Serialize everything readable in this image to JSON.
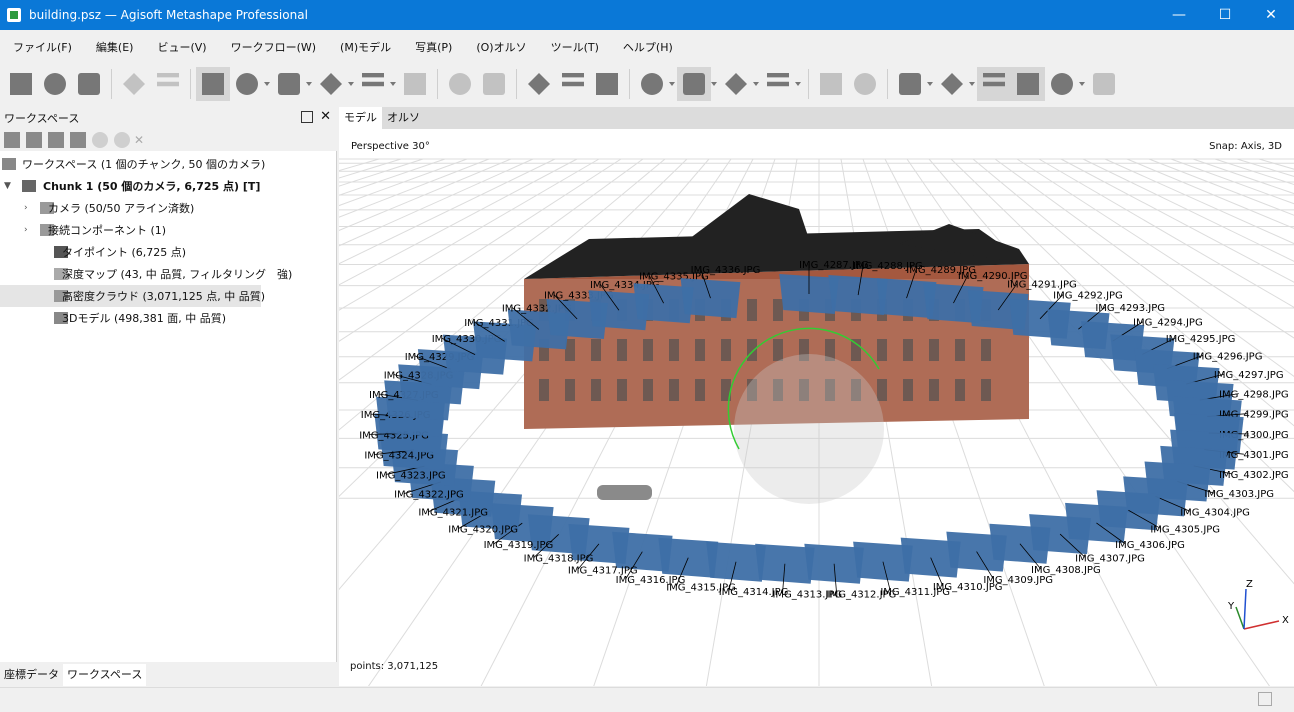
{
  "window": {
    "title": "building.psz — Agisoft Metashape Professional",
    "controls": [
      "—",
      "☐",
      "✕"
    ]
  },
  "menu": [
    "ファイル(F)",
    "編集(E)",
    "ビュー(V)",
    "ワークフロー(W)",
    "(M)モデル",
    "写真(P)",
    "(O)オルソ",
    "ツール(T)",
    "ヘルプ(H)"
  ],
  "toolbar": {
    "buttons": [
      {
        "name": "new-icon",
        "disabled": false
      },
      {
        "name": "open-icon",
        "disabled": false
      },
      {
        "name": "save-icon",
        "disabled": false
      },
      {
        "name": "undo-icon",
        "disabled": true
      },
      {
        "name": "redo-icon",
        "disabled": true
      },
      {
        "name": "navigation-icon",
        "disabled": false,
        "pressed": true
      },
      {
        "name": "rectangle-selection-icon",
        "disabled": false,
        "caret": true
      },
      {
        "name": "move-object-icon",
        "disabled": false,
        "caret": true
      },
      {
        "name": "region-icon",
        "disabled": false,
        "caret": true
      },
      {
        "name": "ruler-icon",
        "disabled": false,
        "caret": true
      },
      {
        "name": "draw-icon",
        "disabled": true
      },
      {
        "name": "delete-selection-icon",
        "disabled": true
      },
      {
        "name": "crop-icon",
        "disabled": true
      },
      {
        "name": "zoom-in-icon",
        "disabled": false
      },
      {
        "name": "zoom-out-icon",
        "disabled": false
      },
      {
        "name": "reset-view-icon",
        "disabled": false
      },
      {
        "name": "points-icon",
        "disabled": false,
        "caret": true
      },
      {
        "name": "dense-cloud-icon",
        "disabled": false,
        "caret": true,
        "pressed": true
      },
      {
        "name": "model-shaded-icon",
        "disabled": false,
        "caret": true
      },
      {
        "name": "tiled-model-icon",
        "disabled": false,
        "caret": true
      },
      {
        "name": "dem-icon",
        "disabled": true
      },
      {
        "name": "ortho-icon",
        "disabled": true
      },
      {
        "name": "globe-icon",
        "disabled": false,
        "caret": true
      },
      {
        "name": "camera-icon",
        "disabled": false,
        "caret": true
      },
      {
        "name": "show-cameras-icon",
        "disabled": false,
        "pressed": true
      },
      {
        "name": "markers-icon",
        "disabled": false,
        "pressed": true
      },
      {
        "name": "images-icon",
        "disabled": false,
        "caret": true
      },
      {
        "name": "layers-icon",
        "disabled": true
      }
    ]
  },
  "workspace": {
    "header": "ワークスペース",
    "tree": [
      {
        "label": "ワークスペース (1 個のチャンク, 50 個のカメラ)",
        "indent": 0,
        "bold": false,
        "icon": "workspace-icon"
      },
      {
        "label": "Chunk 1 (50 個のカメラ, 6,725 点) [T]",
        "indent": 1,
        "bold": true,
        "icon": "chunk-icon",
        "expanded": true
      },
      {
        "label": "カメラ (50/50 アライン済数)",
        "indent": 2,
        "bold": false,
        "icon": "folder-icon",
        "expandable": true
      },
      {
        "label": "接続コンポーネント (1)",
        "indent": 2,
        "bold": false,
        "icon": "folder-icon",
        "expandable": true
      },
      {
        "label": "タイポイント (6,725 点)",
        "indent": 3,
        "bold": false,
        "icon": "tie-points-icon"
      },
      {
        "label": "深度マップ (43, 中 品質, フィルタリング　強)",
        "indent": 3,
        "bold": false,
        "icon": "depth-maps-icon"
      },
      {
        "label": "高密度クラウド (3,071,125 点, 中 品質)",
        "indent": 3,
        "bold": false,
        "icon": "dense-cloud-icon",
        "selected": true
      },
      {
        "label": "3Dモデル (498,381 面, 中 品質)",
        "indent": 3,
        "bold": false,
        "icon": "model-icon"
      }
    ]
  },
  "bottom_tabs": [
    "座標データ",
    "ワークスペース"
  ],
  "view_tabs": [
    "モデル",
    "オルソ"
  ],
  "viewport": {
    "projection": "Perspective 30°",
    "snap": "Snap: Axis, 3D",
    "points": "points: 3,071,125",
    "axes": {
      "x": "X",
      "y": "Y",
      "z": "Z"
    },
    "camera_labels": [
      "IMG_4287.JPG",
      "IMG_4288.JPG",
      "IMG_4289.JPG",
      "IMG_4290.JPG",
      "IMG_4291.JPG",
      "IMG_4292.JPG",
      "IMG_4293.JPG",
      "IMG_4294.JPG",
      "IMG_4295.JPG",
      "IMG_4296.JPG",
      "IMG_4297.JPG",
      "IMG_4298.JPG",
      "IMG_4299.JPG",
      "IMG_4300.JPG",
      "IMG_4301.JPG",
      "IMG_4302.JPG",
      "IMG_4303.JPG",
      "IMG_4304.JPG",
      "IMG_4305.JPG",
      "IMG_4306.JPG",
      "IMG_4307.JPG",
      "IMG_4308.JPG",
      "IMG_4309.JPG",
      "IMG_4310.JPG",
      "IMG_4311.JPG",
      "IMG_4312.JPG",
      "IMG_4313.JPG",
      "IMG_4314.JPG",
      "IMG_4315.JPG",
      "IMG_4316.JPG",
      "IMG_4317.JPG",
      "IMG_4318.JPG",
      "IMG_4319.JPG",
      "IMG_4320.JPG",
      "IMG_4321.JPG",
      "IMG_4322.JPG",
      "IMG_4323.JPG",
      "IMG_4324.JPG",
      "IMG_4325.JPG",
      "IMG_4326.JPG",
      "IMG_4327.JPG",
      "IMG_4328.JPG",
      "IMG_4329.JPG",
      "IMG_4330.JPG",
      "IMG_4331.JPG",
      "IMG_4332.JPG",
      "IMG_4333.JPG",
      "IMG_4334.JPG",
      "IMG_4335.JPG",
      "IMG_4336.JPG"
    ],
    "colors": {
      "camera": "#3e6fa6",
      "grid": "#dcdcdc",
      "brick": "#a4583f",
      "roof": "#222222",
      "axis_x": "#d03030",
      "axis_y": "#2a8a2a",
      "axis_z": "#2050d0"
    }
  }
}
